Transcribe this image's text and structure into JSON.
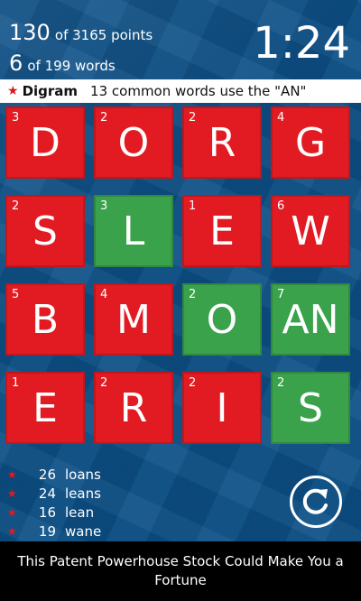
{
  "score": {
    "points": "130",
    "points_of": "of 3165 points",
    "words": "6",
    "words_of": "of 199 words"
  },
  "timer": "1:24",
  "hint": {
    "star": "★",
    "title": "Digram",
    "text": "13 common words use the \"AN\""
  },
  "colors": {
    "red_tile": "#e21b23",
    "green_tile": "#3aa24a",
    "background": "#0c4f86"
  },
  "tiles": [
    {
      "value": "3",
      "letter": "D",
      "state": "red"
    },
    {
      "value": "2",
      "letter": "O",
      "state": "red"
    },
    {
      "value": "2",
      "letter": "R",
      "state": "red"
    },
    {
      "value": "4",
      "letter": "G",
      "state": "red"
    },
    {
      "value": "2",
      "letter": "S",
      "state": "red"
    },
    {
      "value": "3",
      "letter": "L",
      "state": "green"
    },
    {
      "value": "1",
      "letter": "E",
      "state": "red"
    },
    {
      "value": "6",
      "letter": "W",
      "state": "red"
    },
    {
      "value": "5",
      "letter": "B",
      "state": "red"
    },
    {
      "value": "4",
      "letter": "M",
      "state": "red"
    },
    {
      "value": "2",
      "letter": "O",
      "state": "green"
    },
    {
      "value": "7",
      "letter": "AN",
      "state": "green"
    },
    {
      "value": "1",
      "letter": "E",
      "state": "red"
    },
    {
      "value": "2",
      "letter": "R",
      "state": "red"
    },
    {
      "value": "2",
      "letter": "I",
      "state": "red"
    },
    {
      "value": "2",
      "letter": "S",
      "state": "green"
    }
  ],
  "found_words": [
    {
      "star": "★",
      "points": "26",
      "word": "loans"
    },
    {
      "star": "★",
      "points": "24",
      "word": "leans"
    },
    {
      "star": "★",
      "points": "16",
      "word": "lean"
    },
    {
      "star": "★",
      "points": "19",
      "word": "wane"
    }
  ],
  "refresh_icon": "refresh-icon",
  "ad": {
    "text": "This Patent Powerhouse Stock Could Make You a Fortune"
  }
}
